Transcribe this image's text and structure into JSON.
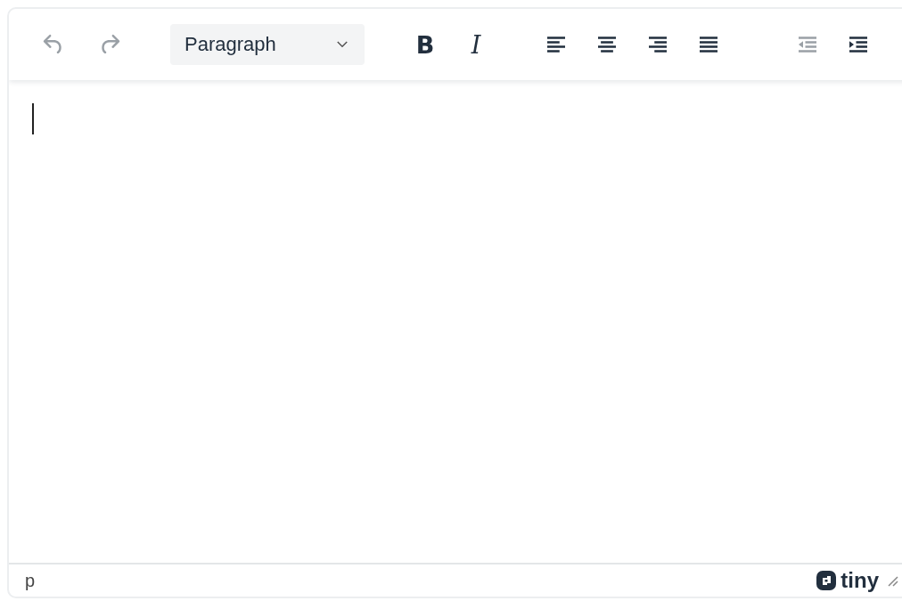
{
  "toolbar": {
    "groups": [
      {
        "items": [
          {
            "kind": "undo",
            "disabled": true
          },
          {
            "kind": "redo",
            "disabled": true
          }
        ]
      },
      {
        "items": [
          {
            "kind": "select",
            "value": "Paragraph"
          }
        ]
      },
      {
        "items": [
          {
            "kind": "bold",
            "label": "B"
          },
          {
            "kind": "italic",
            "label": "I"
          }
        ]
      },
      {
        "items": [
          {
            "kind": "align-left"
          },
          {
            "kind": "align-center"
          },
          {
            "kind": "align-right"
          },
          {
            "kind": "justify"
          }
        ]
      },
      {
        "items": [
          {
            "kind": "outdent",
            "disabled": true
          },
          {
            "kind": "indent",
            "disabled": false
          }
        ]
      }
    ]
  },
  "editor": {
    "cursor": true
  },
  "status_bar": {
    "path": "p",
    "brand": "tiny"
  }
}
